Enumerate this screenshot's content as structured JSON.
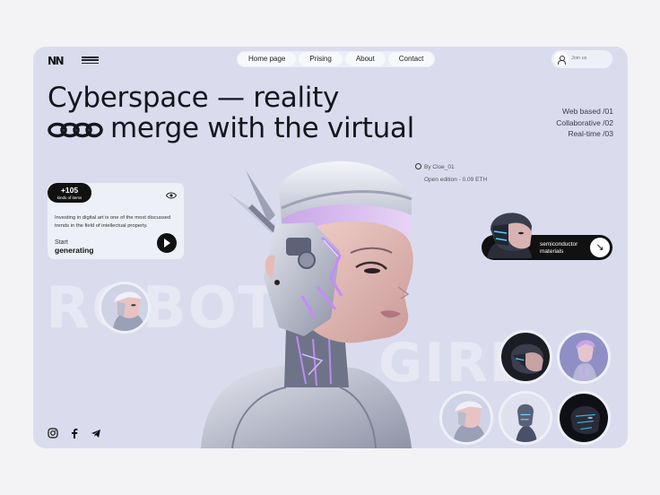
{
  "header": {
    "logo": "NN",
    "nav": [
      "Home page",
      "Prising",
      "About",
      "Contact"
    ],
    "join_label": "Join us"
  },
  "hero": {
    "title_line1": "Cyberspace — reality",
    "title_line2": "merge with the virtual",
    "features": [
      "Web based  /01",
      "Collaborative  /02",
      "Real-time  /03"
    ],
    "bg_word_1": "ROBOT",
    "bg_word_2": "GIRL"
  },
  "byline": {
    "author": "By Cloe_01",
    "edition": "Open edition - 0.09 ETH"
  },
  "card": {
    "count": "+105",
    "count_sub": "kinds of items",
    "text": "Investing in digital art is one of the most discussed trends in the field of intellectual property.",
    "start_label": "Start",
    "start_action": "generating"
  },
  "semiconductor": {
    "label_line1": "semiconductor",
    "label_line2": "materials"
  },
  "social": [
    "instagram-icon",
    "facebook-icon",
    "telegram-icon"
  ],
  "colors": {
    "background": "#dadcee",
    "accent": "#111111",
    "neon": "#b98cf5"
  }
}
